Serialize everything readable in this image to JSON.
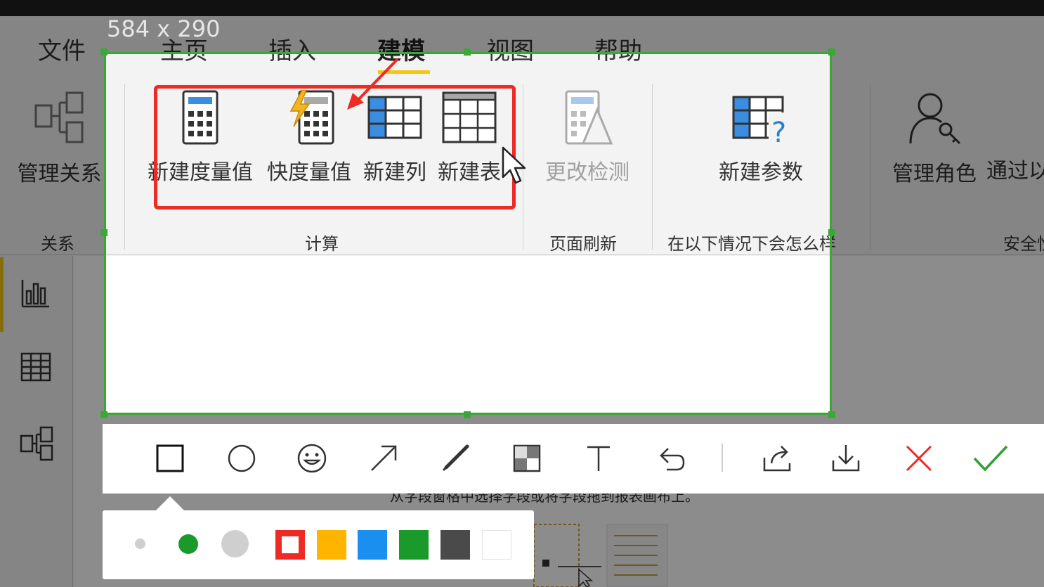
{
  "ribbon": {
    "tabs": [
      {
        "label": "文件"
      },
      {
        "label": "主页"
      },
      {
        "label": "插入"
      },
      {
        "label": "建模"
      },
      {
        "label": "视图"
      },
      {
        "label": "帮助"
      }
    ],
    "active_tab": "建模",
    "buttons": {
      "manage_relationships": "管理关系",
      "new_measure": "新建度量值",
      "quick_measure": "快度量值",
      "new_column": "新建列",
      "new_table": "新建表",
      "change_detection": "更改检测",
      "new_parameter": "新建参数",
      "manage_roles": "管理角色",
      "view_as": "通过以"
    },
    "groups": {
      "relationships": "关系",
      "calculations": "计算",
      "page_refresh": "页面刷新",
      "what_if": "在以下情况下会怎么样",
      "security": "安全性"
    }
  },
  "screenshot_tool": {
    "size_label": "584 x 290",
    "tools": [
      "rectangle-icon",
      "circle-icon",
      "emoji-icon",
      "arrow-icon",
      "pen-icon",
      "mosaic-icon",
      "text-icon",
      "undo-icon",
      "share-icon",
      "download-icon",
      "cancel-icon",
      "confirm-icon"
    ],
    "colors": {
      "selection": "#39a834",
      "annotation": "#ee2a24",
      "palette": [
        "#ee2a24",
        "#ffb400",
        "#1a8ff0",
        "#1a9a2a",
        "#4a4a4a",
        "#ffffff"
      ],
      "selected_size_color": "#1a9a2a"
    }
  },
  "canvas": {
    "hint_text": "从字段窗格中选择字段或将字段拖到报表画布上。"
  }
}
